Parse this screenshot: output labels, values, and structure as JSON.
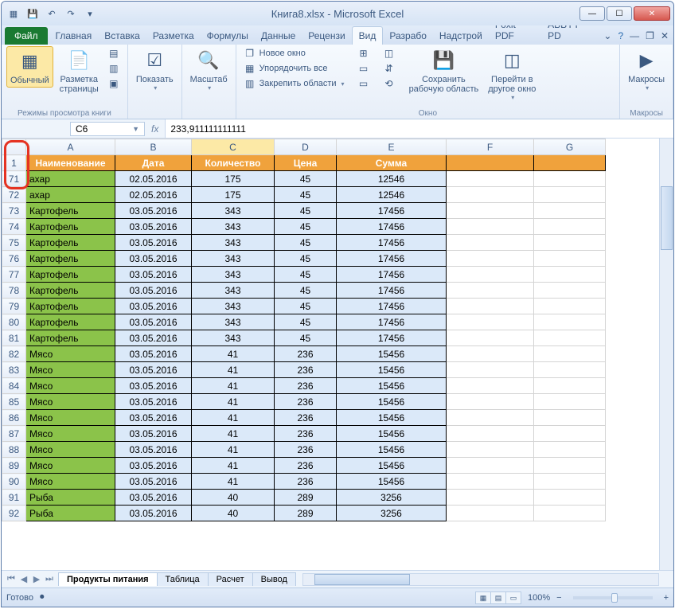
{
  "title": "Книга8.xlsx - Microsoft Excel",
  "tabs": {
    "file": "Файл",
    "list": [
      "Главная",
      "Вставка",
      "Разметка",
      "Формулы",
      "Данные",
      "Рецензи",
      "Вид",
      "Разрабо",
      "Надстрой",
      "Foxit PDF",
      "ABBYY PD"
    ],
    "active_index": 6
  },
  "ribbon": {
    "g1": {
      "label": "Режимы просмотра книги",
      "normal": "Обычный",
      "pagelayout": "Разметка\nстраницы"
    },
    "g2": {
      "show": "Показать"
    },
    "g3": {
      "zoom": "Масштаб"
    },
    "g4": {
      "label": "Окно",
      "new": "Новое окно",
      "arrange": "Упорядочить все",
      "freeze": "Закрепить области",
      "save": "Сохранить\nрабочую область",
      "goto": "Перейти в\nдругое окно"
    },
    "g5": {
      "label": "Макросы",
      "macros": "Макросы"
    }
  },
  "namebox": "C6",
  "formula": "233,911111111111",
  "columns": [
    "A",
    "B",
    "C",
    "D",
    "E",
    "F",
    "G"
  ],
  "selected_col_index": 2,
  "header_row": {
    "num": "1",
    "cells": [
      "Наименование",
      "Дата",
      "Количество",
      "Цена",
      "Сумма"
    ]
  },
  "rows": [
    {
      "n": "71",
      "a": "ахар",
      "b": "02.05.2016",
      "c": "175",
      "d": "45",
      "e": "12546"
    },
    {
      "n": "72",
      "a": "ахар",
      "b": "02.05.2016",
      "c": "175",
      "d": "45",
      "e": "12546"
    },
    {
      "n": "73",
      "a": "Картофель",
      "b": "03.05.2016",
      "c": "343",
      "d": "45",
      "e": "17456"
    },
    {
      "n": "74",
      "a": "Картофель",
      "b": "03.05.2016",
      "c": "343",
      "d": "45",
      "e": "17456"
    },
    {
      "n": "75",
      "a": "Картофель",
      "b": "03.05.2016",
      "c": "343",
      "d": "45",
      "e": "17456"
    },
    {
      "n": "76",
      "a": "Картофель",
      "b": "03.05.2016",
      "c": "343",
      "d": "45",
      "e": "17456"
    },
    {
      "n": "77",
      "a": "Картофель",
      "b": "03.05.2016",
      "c": "343",
      "d": "45",
      "e": "17456"
    },
    {
      "n": "78",
      "a": "Картофель",
      "b": "03.05.2016",
      "c": "343",
      "d": "45",
      "e": "17456"
    },
    {
      "n": "79",
      "a": "Картофель",
      "b": "03.05.2016",
      "c": "343",
      "d": "45",
      "e": "17456"
    },
    {
      "n": "80",
      "a": "Картофель",
      "b": "03.05.2016",
      "c": "343",
      "d": "45",
      "e": "17456"
    },
    {
      "n": "81",
      "a": "Картофель",
      "b": "03.05.2016",
      "c": "343",
      "d": "45",
      "e": "17456"
    },
    {
      "n": "82",
      "a": "Мясо",
      "b": "03.05.2016",
      "c": "41",
      "d": "236",
      "e": "15456"
    },
    {
      "n": "83",
      "a": "Мясо",
      "b": "03.05.2016",
      "c": "41",
      "d": "236",
      "e": "15456"
    },
    {
      "n": "84",
      "a": "Мясо",
      "b": "03.05.2016",
      "c": "41",
      "d": "236",
      "e": "15456"
    },
    {
      "n": "85",
      "a": "Мясо",
      "b": "03.05.2016",
      "c": "41",
      "d": "236",
      "e": "15456"
    },
    {
      "n": "86",
      "a": "Мясо",
      "b": "03.05.2016",
      "c": "41",
      "d": "236",
      "e": "15456"
    },
    {
      "n": "87",
      "a": "Мясо",
      "b": "03.05.2016",
      "c": "41",
      "d": "236",
      "e": "15456"
    },
    {
      "n": "88",
      "a": "Мясо",
      "b": "03.05.2016",
      "c": "41",
      "d": "236",
      "e": "15456"
    },
    {
      "n": "89",
      "a": "Мясо",
      "b": "03.05.2016",
      "c": "41",
      "d": "236",
      "e": "15456"
    },
    {
      "n": "90",
      "a": "Мясо",
      "b": "03.05.2016",
      "c": "41",
      "d": "236",
      "e": "15456"
    },
    {
      "n": "91",
      "a": "Рыба",
      "b": "03.05.2016",
      "c": "40",
      "d": "289",
      "e": "3256"
    },
    {
      "n": "92",
      "a": "Рыба",
      "b": "03.05.2016",
      "c": "40",
      "d": "289",
      "e": "3256"
    }
  ],
  "sheets": {
    "active": "Продукты питания",
    "others": [
      "Таблица",
      "Расчет",
      "Вывод"
    ]
  },
  "status": {
    "ready": "Готово",
    "zoom": "100%"
  }
}
